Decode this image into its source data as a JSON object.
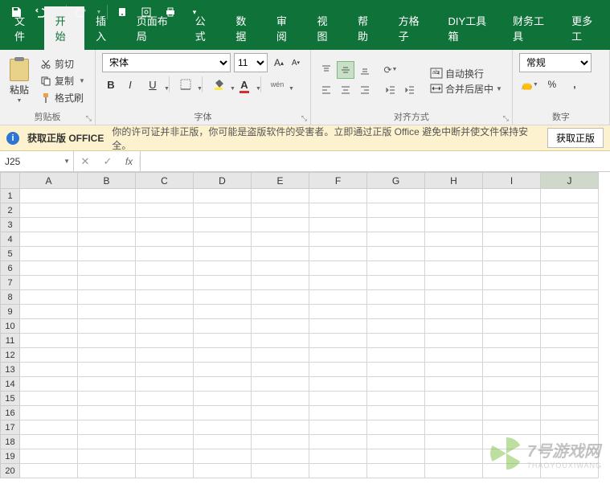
{
  "titlebar": {
    "save_tip": "保存",
    "undo_tip": "撤销",
    "redo_tip": "重做"
  },
  "tabs": {
    "file": "文件",
    "home": "开始",
    "insert": "插入",
    "layout": "页面布局",
    "formula": "公式",
    "data": "数据",
    "review": "审阅",
    "view": "视图",
    "help": "帮助",
    "fanggezi": "方格子",
    "diy": "DIY工具箱",
    "finance": "财务工具",
    "more": "更多工"
  },
  "ribbon": {
    "clipboard": {
      "paste": "粘贴",
      "cut": "剪切",
      "copy": "复制",
      "format_painter": "格式刷",
      "group_label": "剪贴板"
    },
    "font": {
      "name": "宋体",
      "size": "11",
      "group_label": "字体",
      "bold": "B",
      "italic": "I",
      "underline": "U",
      "wen": "wén"
    },
    "align": {
      "wrap": "自动换行",
      "merge": "合并后居中",
      "group_label": "对齐方式"
    },
    "number": {
      "format": "常规",
      "group_label": "数字"
    }
  },
  "warning": {
    "title": "获取正版 OFFICE",
    "message": "你的许可证并非正版，你可能是盗版软件的受害者。立即通过正版 Office 避免中断并使文件保持安全。",
    "action": "获取正版"
  },
  "fxbar": {
    "namebox": "J25",
    "fx_label": "fx",
    "formula": ""
  },
  "grid": {
    "columns": [
      "A",
      "B",
      "C",
      "D",
      "E",
      "F",
      "G",
      "H",
      "I",
      "J"
    ],
    "row_count": 20,
    "active_cell": "J25",
    "active_col_idx": 9
  },
  "watermark": {
    "text": "7号游戏网",
    "sub": "7HAOYOUXIWANG"
  }
}
